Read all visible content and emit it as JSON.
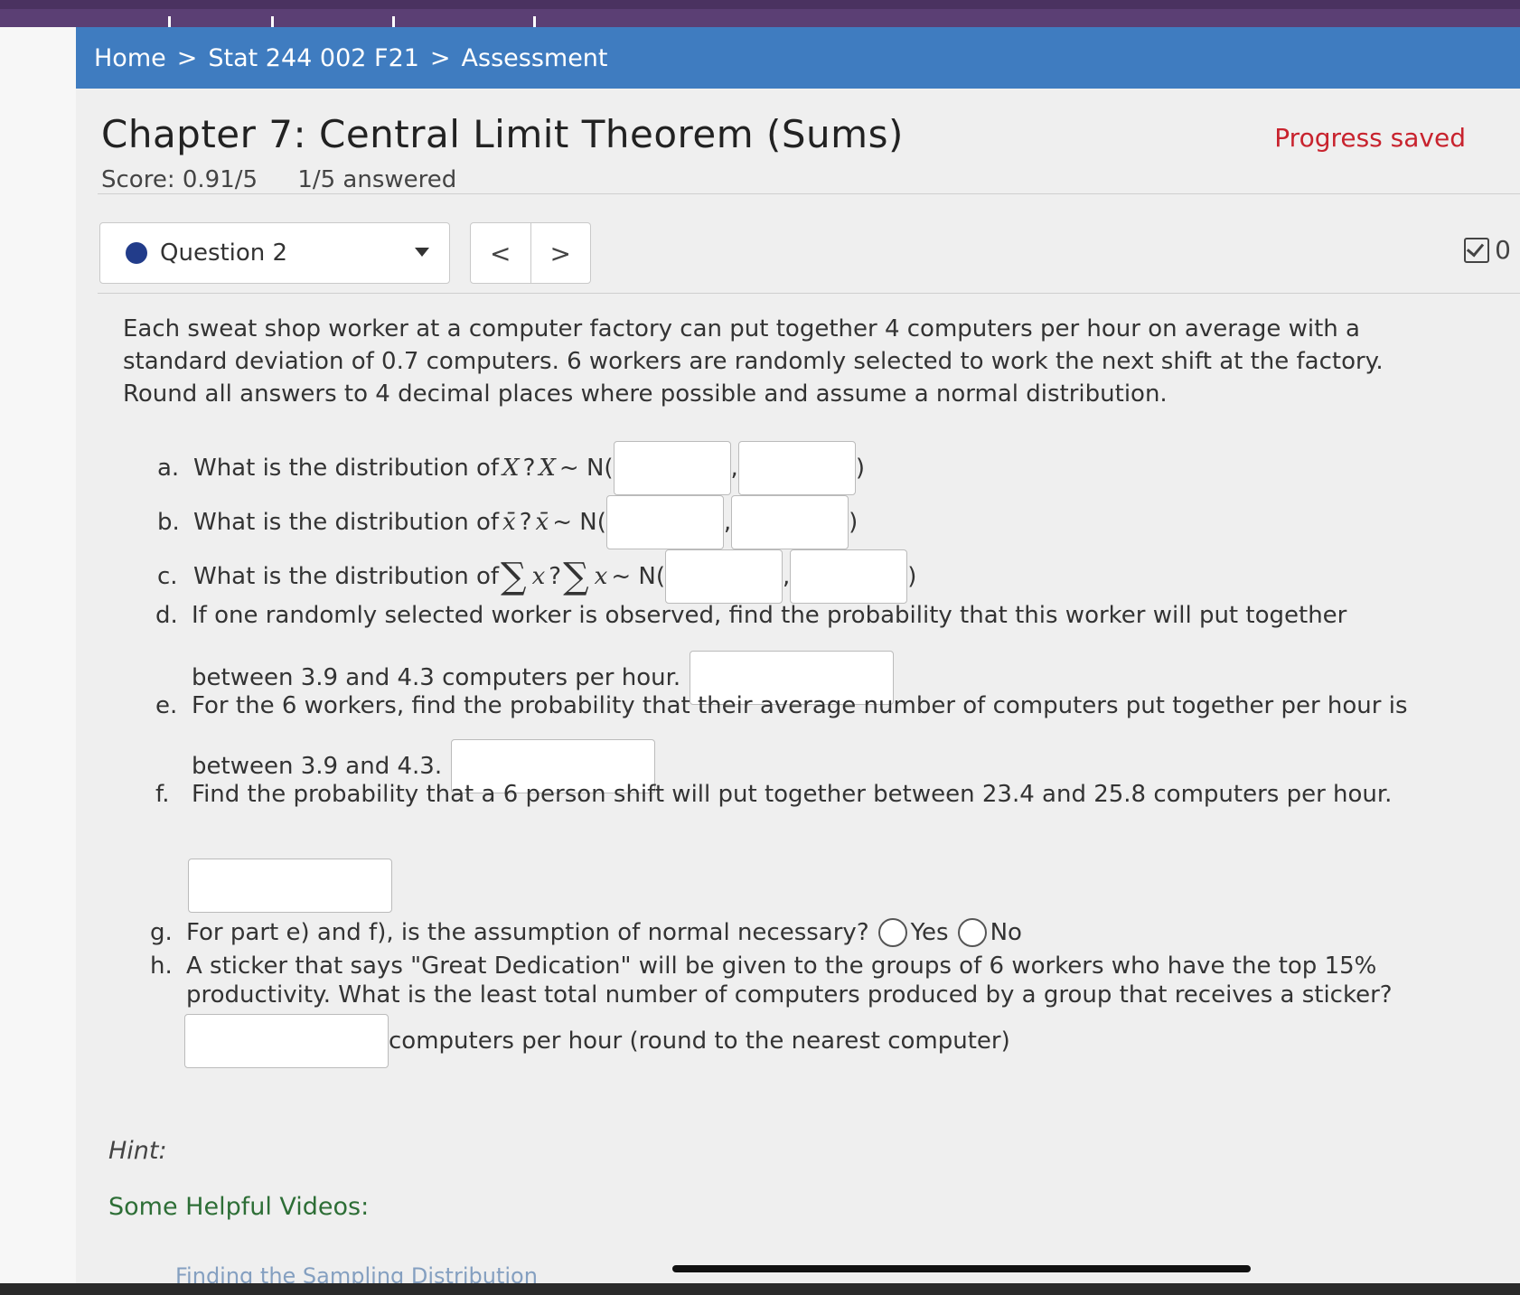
{
  "breadcrumb": {
    "home": "Home",
    "sep1": ">",
    "course": "Stat 244 002 F21",
    "sep2": ">",
    "page": "Assessment"
  },
  "header": {
    "title": "Chapter 7: Central Limit Theorem (Sums)",
    "progress": "Progress saved",
    "score": "Score: 0.91/5",
    "answered": "1/5 answered"
  },
  "question_nav": {
    "label": "Question 2",
    "prev": "<",
    "next": ">",
    "checked_count": "0"
  },
  "intro": "Each sweat shop worker at a computer factory can put together 4 computers per hour on average with a standard deviation of 0.7 computers. 6 workers are randomly selected to work the next shift at the factory. Round all answers to 4 decimal places where possible and assume a normal distribution.",
  "parts": {
    "a": {
      "letter": "a.",
      "text": "What is the distribution of ",
      "var": "X",
      "q": "?",
      "var2": "X",
      "dist": " ~ N("
    },
    "b": {
      "letter": "b.",
      "text": "What is the distribution of ",
      "var": "x̄",
      "q": "?",
      "var2": "x̄",
      "dist": " ~ N("
    },
    "c": {
      "letter": "c.",
      "text": "What is the distribution of ",
      "sigma": "∑",
      "var": "x",
      "q": "?",
      "var2": "x",
      "dist": " ~ N("
    },
    "d": {
      "letter": "d.",
      "line1": "If one randomly selected worker is observed, find the probability that this worker will put together",
      "line2": "between 3.9 and 4.3 computers per hour."
    },
    "e": {
      "letter": "e.",
      "line1": "For the 6 workers, find the probability that their average number of computers put together per hour is",
      "line2": "between 3.9 and 4.3."
    },
    "f": {
      "letter": "f.",
      "line1": "Find the probability that a 6 person shift will put together between 23.4 and 25.8 computers per hour."
    },
    "g": {
      "letter": "g.",
      "text": "For part e) and f), is the assumption of normal necessary?",
      "yes": "Yes",
      "no": "No"
    },
    "h": {
      "letter": "h.",
      "line1": "A sticker that says \"Great Dedication\" will be given to the groups of 6 workers who have the top 15%",
      "line2": "productivity. What is the least total number of computers produced by a group that receives a sticker?",
      "suffix": "computers per hour (round to the nearest computer)"
    }
  },
  "comma": ",",
  "close_paren": ")",
  "hint": "Hint:",
  "videos_heading": "Some Helpful Videos:",
  "video_link": "Finding the Sampling Distribution",
  "colors": {
    "accent": "#3f7cc0",
    "topbar": "#5b3f74",
    "progress": "#c8232e",
    "videos": "#2d6e36"
  }
}
